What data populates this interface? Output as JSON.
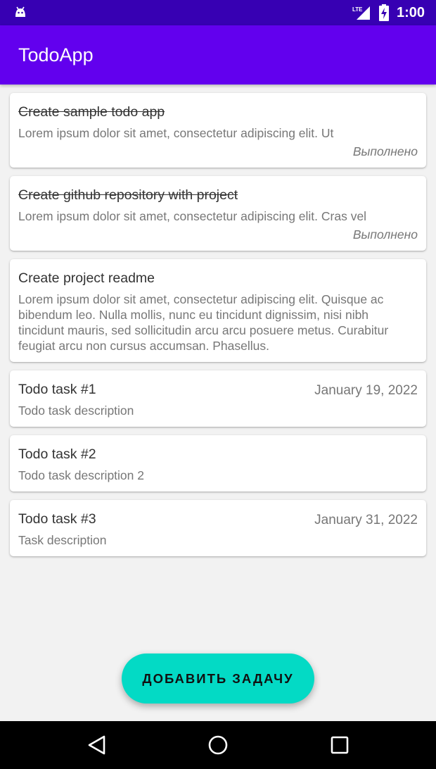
{
  "status_bar": {
    "time": "1:00",
    "network": "LTE",
    "icons": [
      "android-icon",
      "lte-signal-icon",
      "battery-charging-icon"
    ]
  },
  "app_bar": {
    "title": "TodoApp",
    "color": "#6200ee"
  },
  "tasks": [
    {
      "title": "Create sample todo app",
      "description": "Lorem ipsum dolor sit amet, consectetur adipiscing elit. Ut",
      "status": "Выполнено",
      "date": "",
      "completed": true
    },
    {
      "title": "Create github repository with project",
      "description": "Lorem ipsum dolor sit amet, consectetur adipiscing elit. Cras vel",
      "status": "Выполнено",
      "date": "",
      "completed": true
    },
    {
      "title": "Create project readme",
      "description": "Lorem ipsum dolor sit amet, consectetur adipiscing elit. Quisque ac bibendum leo. Nulla mollis, nunc eu tincidunt dignissim, nisi nibh tincidunt mauris, sed sollicitudin arcu arcu posuere metus. Curabitur feugiat arcu non cursus accumsan. Phasellus.",
      "status": "",
      "date": "",
      "completed": false
    },
    {
      "title": "Todo task #1",
      "description": "Todo task description",
      "status": "",
      "date": "January 19, 2022",
      "completed": false
    },
    {
      "title": "Todo task #2",
      "description": "Todo task description 2",
      "status": "",
      "date": "",
      "completed": false
    },
    {
      "title": "Todo task #3",
      "description": "Task description",
      "status": "",
      "date": "January 31, 2022",
      "completed": false
    }
  ],
  "fab": {
    "label": "ДОБАВИТЬ ЗАДАЧУ",
    "color": "#03dac5"
  },
  "nav_bar": {
    "icons": [
      "back-icon",
      "home-icon",
      "recents-icon"
    ]
  }
}
